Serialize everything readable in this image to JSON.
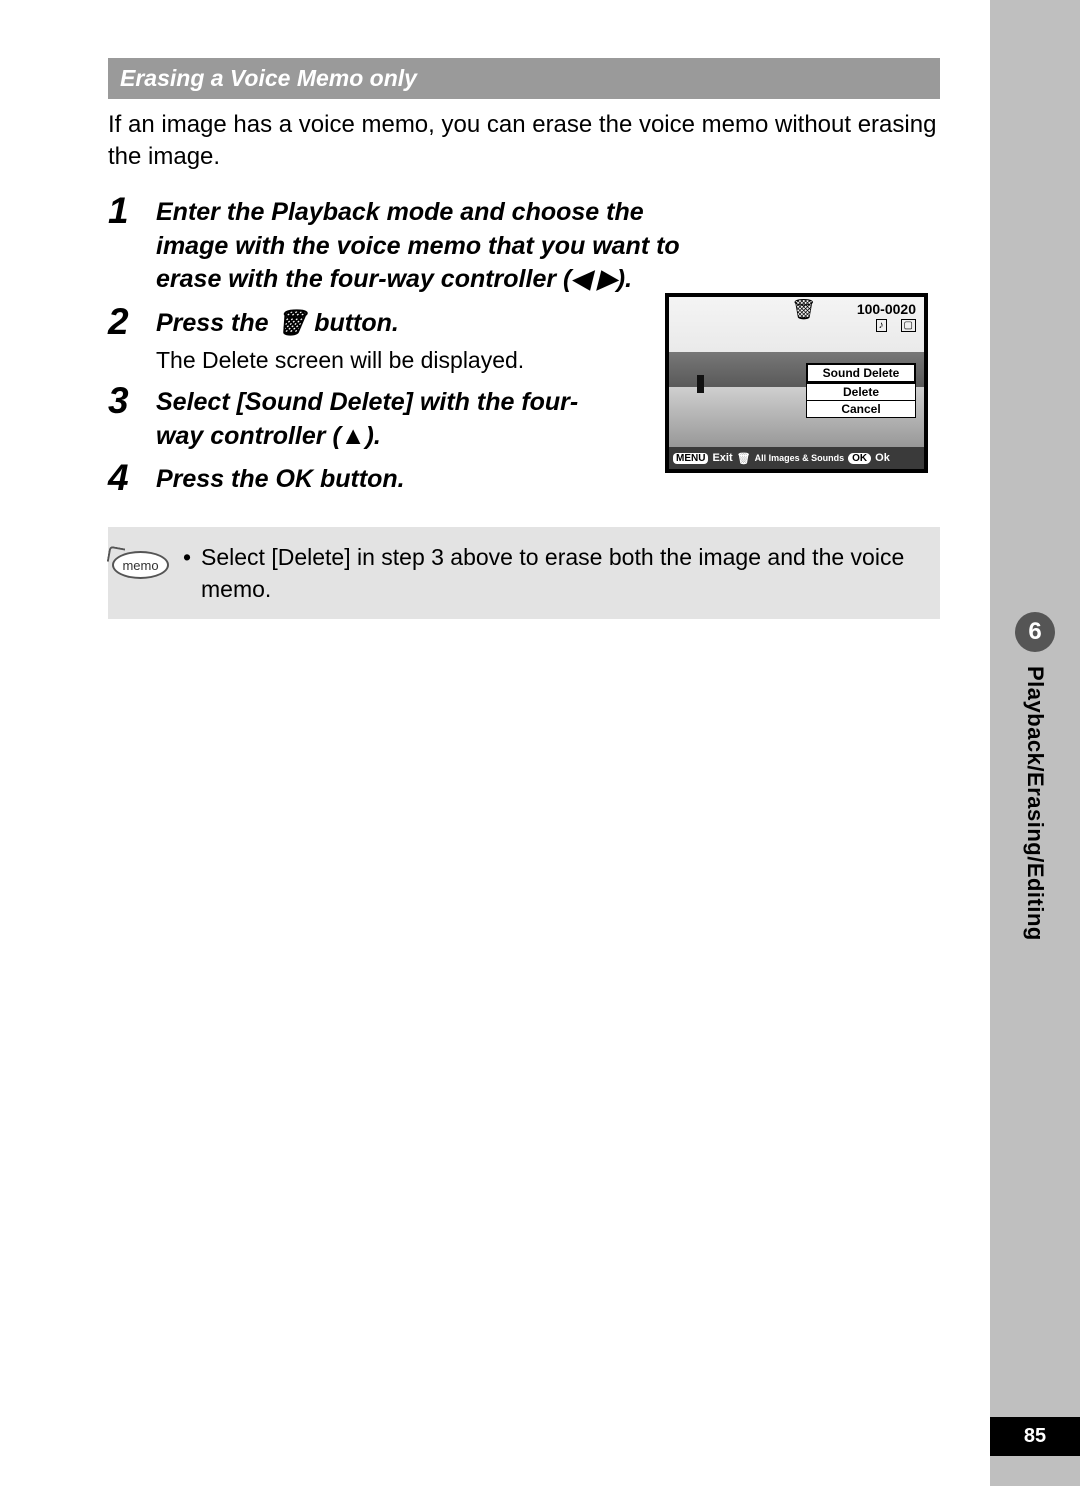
{
  "section_title": "Erasing a Voice Memo only",
  "intro": "If an image has a voice memo, you can erase the voice memo without erasing the image.",
  "steps": {
    "s1": {
      "num": "1",
      "title": "Enter the Playback mode and choose the image with the voice memo that you want to erase with the four-way controller (◀ ▶)."
    },
    "s2": {
      "num": "2",
      "title": "Press the 🗑 button.",
      "sub": "The Delete screen will be displayed."
    },
    "s3": {
      "num": "3",
      "title": "Select [Sound Delete] with the four-way controller (▲)."
    },
    "s4": {
      "num": "4",
      "title": "Press the OK button."
    }
  },
  "lcd": {
    "file_number": "100-0020",
    "options": {
      "opt1": "Sound Delete",
      "opt2": "Delete",
      "opt3": "Cancel"
    },
    "bar": {
      "menu": "MENU",
      "exit": "Exit",
      "all": "All Images & Sounds",
      "ok_chip": "OK",
      "ok": "Ok"
    }
  },
  "memo": {
    "label": "memo",
    "text": "Select [Delete] in step 3 above to erase both the image and the voice memo."
  },
  "side": {
    "chapter": "6",
    "title": "Playback/Erasing/Editing"
  },
  "page_number": "85"
}
